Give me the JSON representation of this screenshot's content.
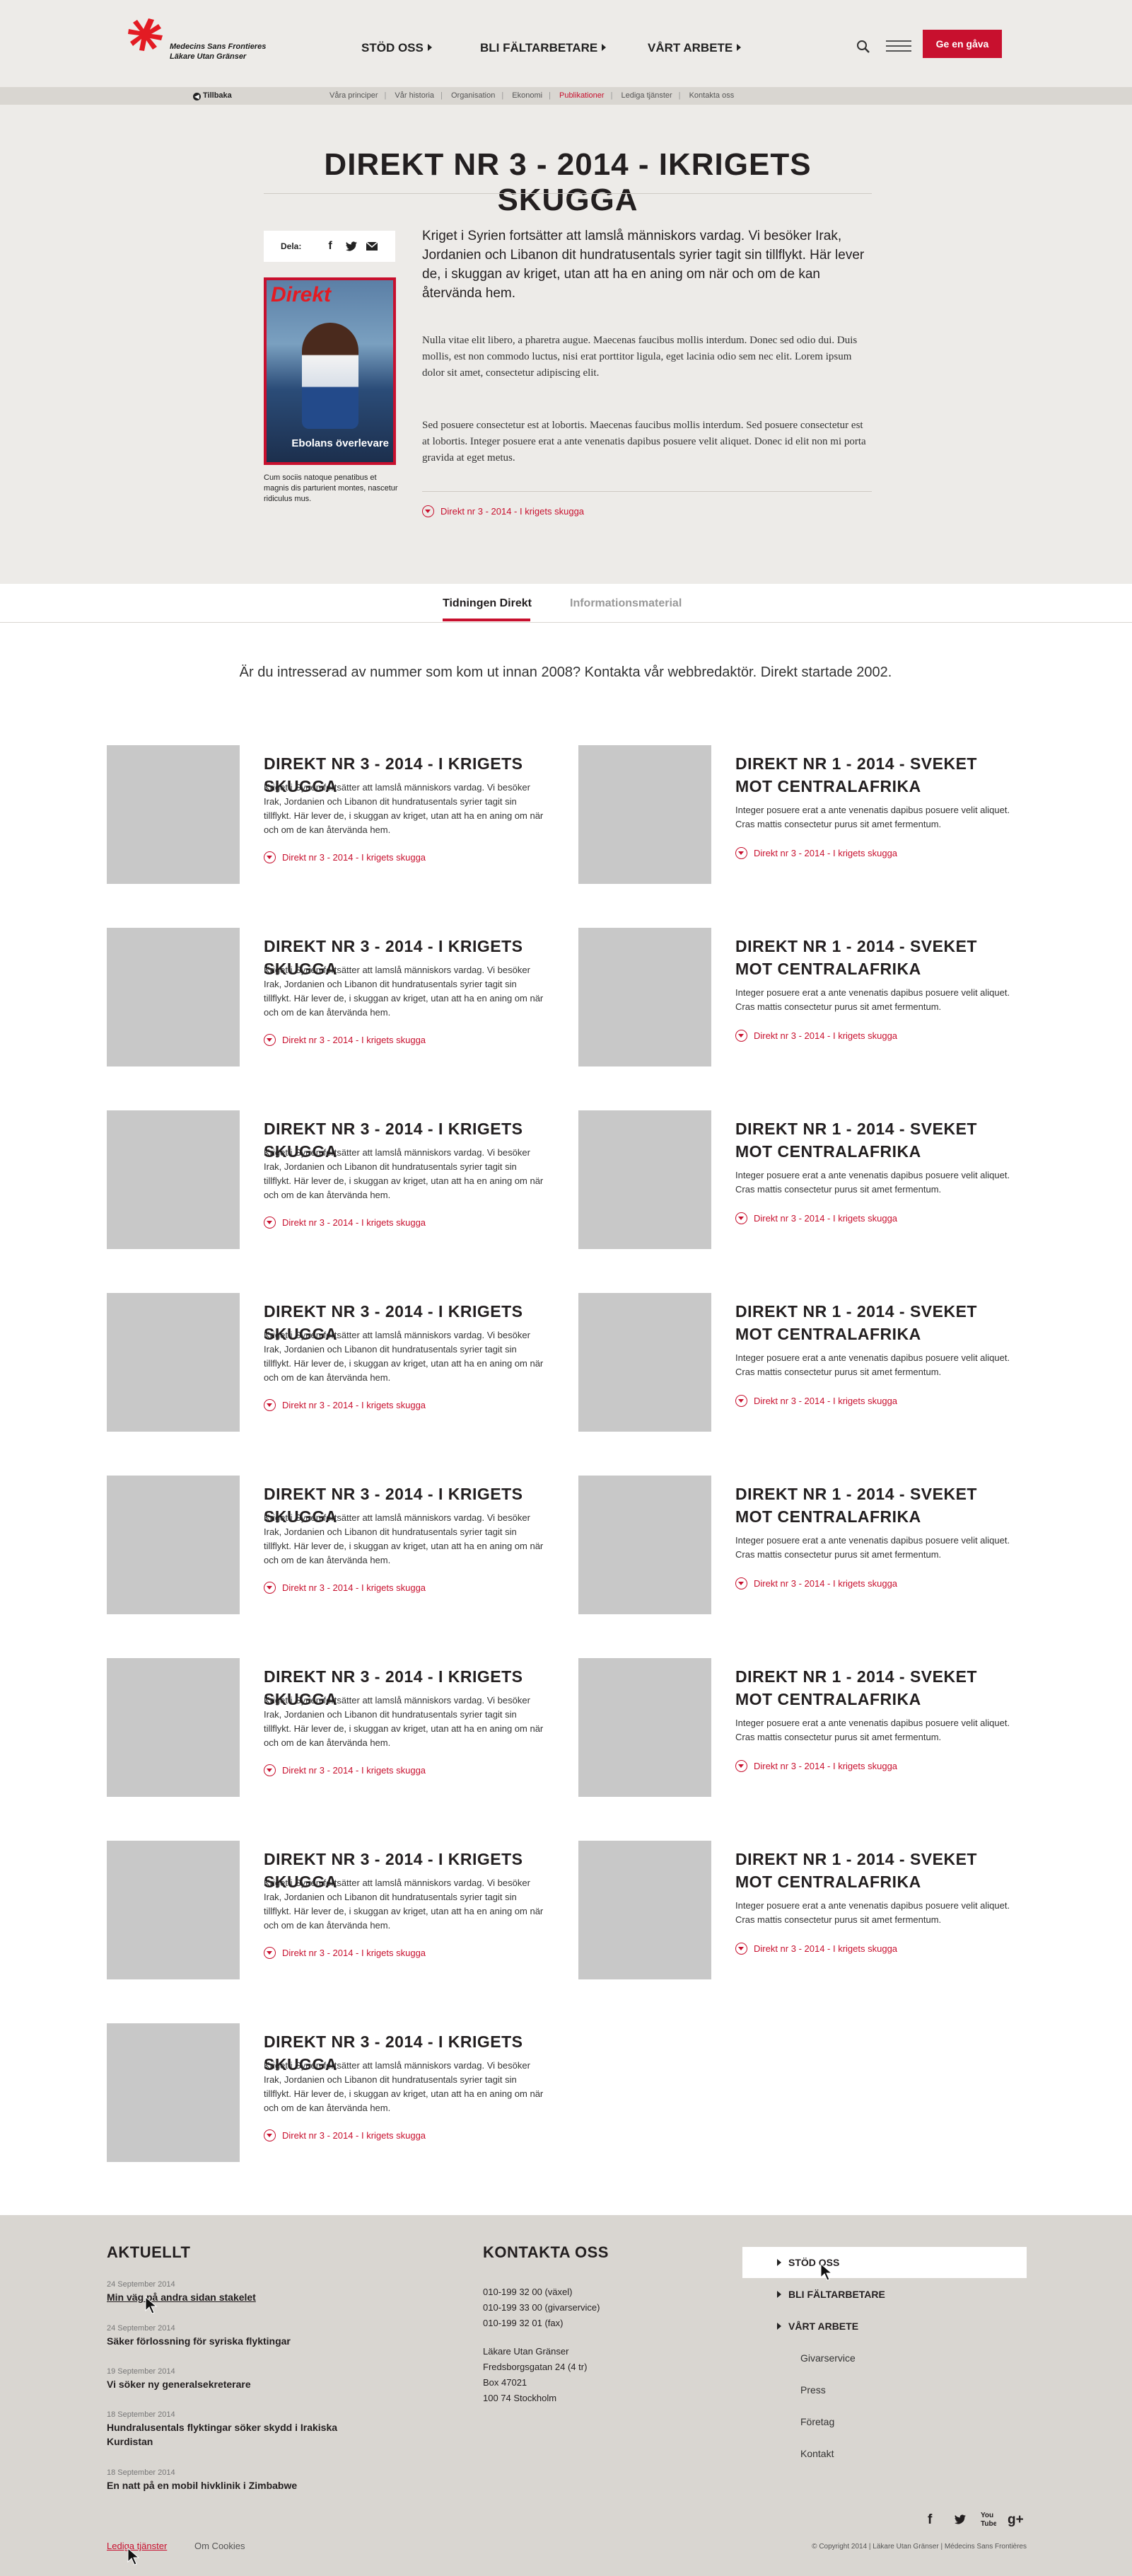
{
  "header": {
    "logo_line1": "Medecins Sans Frontieres",
    "logo_line2": "Läkare Utan Gränser",
    "nav": [
      {
        "label": "STÖD OSS"
      },
      {
        "label": "BLI FÄLTARBETARE"
      },
      {
        "label": "VÅRT ARBETE"
      }
    ],
    "search_icon": "search-icon",
    "menu_icon": "hamburger-icon",
    "donate_label": "Ge en gåva",
    "brand_color": "#c8102e"
  },
  "subnav": {
    "back_label": "Tillbaka",
    "links": [
      "Våra principer",
      "Vår historia",
      "Organisation",
      "Ekonomi",
      "Publikationer",
      "Lediga tjänster",
      "Kontakta oss"
    ],
    "active": "Publikationer"
  },
  "hero": {
    "title": "DIREKT NR 3 - 2014 - IKRIGETS SKUGGA",
    "share_label": "Dela:",
    "share_icons": [
      "facebook-icon",
      "twitter-icon",
      "email-icon"
    ],
    "cover_masthead": "Direkt",
    "cover_caption_text": "Ebolans överlevare",
    "cover_caption": "Cum sociis natoque penatibus et magnis dis parturient montes, nascetur ridiculus mus.",
    "lead": "Kriget i Syrien fortsätter att lamslå människors vardag. Vi besöker Irak, Jordanien och Libanon dit hundratusentals syrier tagit sin tillflykt. Här lever de, i skuggan av kriget, utan att ha en aning om när och om de kan återvända hem.",
    "body1": "Nulla vitae elit libero, a pharetra augue. Maecenas faucibus mollis interdum. Donec sed odio dui. Duis mollis, est non commodo luctus, nisi erat porttitor ligula, eget lacinia odio sem nec elit. Lorem ipsum dolor sit amet, consectetur adipiscing elit.",
    "body2": "Sed posuere consectetur est at lobortis. Maecenas faucibus mollis interdum. Sed posuere consectetur est at lobortis. Integer posuere erat a ante venenatis dapibus posuere velit aliquet. Donec id elit non mi porta gravida at eget metus.",
    "link": "Direkt nr 3 - 2014 - I krigets skugga"
  },
  "tabs": [
    {
      "label": "Tidningen Direkt",
      "active": true
    },
    {
      "label": "Informationsmaterial",
      "active": false
    }
  ],
  "intro": "Är du intresserad av nummer som kom ut innan 2008? Kontakta vår webbredaktör. Direkt startade 2002.",
  "cards_left": [
    {
      "title": "DIREKT NR 3 - 2014 - I KRIGETS SKUGGA",
      "text": "Kriget i Syrien fortsätter att lamslå människors vardag. Vi besöker Irak, Jordanien och Libanon dit hundratusentals syrier tagit sin tillflykt. Här lever de, i skuggan av kriget, utan att ha en aning om när och om de kan återvända hem.",
      "link": "Direkt nr 3 - 2014 - I krigets skugga"
    },
    {
      "title": "DIREKT NR 3 - 2014 - I KRIGETS SKUGGA",
      "text": "Kriget i Syrien fortsätter att lamslå människors vardag. Vi besöker Irak, Jordanien och Libanon dit hundratusentals syrier tagit sin tillflykt. Här lever de, i skuggan av kriget, utan att ha en aning om när och om de kan återvända hem.",
      "link": "Direkt nr 3 - 2014 - I krigets skugga"
    },
    {
      "title": "DIREKT NR 3 - 2014 - I KRIGETS SKUGGA",
      "text": "Kriget i Syrien fortsätter att lamslå människors vardag. Vi besöker Irak, Jordanien och Libanon dit hundratusentals syrier tagit sin tillflykt. Här lever de, i skuggan av kriget, utan att ha en aning om när och om de kan återvända hem.",
      "link": "Direkt nr 3 - 2014 - I krigets skugga"
    },
    {
      "title": "DIREKT NR 3 - 2014 - I KRIGETS SKUGGA",
      "text": "Kriget i Syrien fortsätter att lamslå människors vardag. Vi besöker Irak, Jordanien och Libanon dit hundratusentals syrier tagit sin tillflykt. Här lever de, i skuggan av kriget, utan att ha en aning om när och om de kan återvända hem.",
      "link": "Direkt nr 3 - 2014 - I krigets skugga"
    },
    {
      "title": "DIREKT NR 3 - 2014 - I KRIGETS SKUGGA",
      "text": "Kriget i Syrien fortsätter att lamslå människors vardag. Vi besöker Irak, Jordanien och Libanon dit hundratusentals syrier tagit sin tillflykt. Här lever de, i skuggan av kriget, utan att ha en aning om när och om de kan återvända hem.",
      "link": "Direkt nr 3 - 2014 - I krigets skugga"
    },
    {
      "title": "DIREKT NR 3 - 2014 - I KRIGETS SKUGGA",
      "text": "Kriget i Syrien fortsätter att lamslå människors vardag. Vi besöker Irak, Jordanien och Libanon dit hundratusentals syrier tagit sin tillflykt. Här lever de, i skuggan av kriget, utan att ha en aning om när och om de kan återvända hem.",
      "link": "Direkt nr 3 - 2014 - I krigets skugga"
    },
    {
      "title": "DIREKT NR 3 - 2014 - I KRIGETS SKUGGA",
      "text": "Kriget i Syrien fortsätter att lamslå människors vardag. Vi besöker Irak, Jordanien och Libanon dit hundratusentals syrier tagit sin tillflykt. Här lever de, i skuggan av kriget, utan att ha en aning om när och om de kan återvända hem.",
      "link": "Direkt nr 3 - 2014 - I krigets skugga"
    },
    {
      "title": "DIREKT NR 3 - 2014 - I KRIGETS SKUGGA",
      "text": "Kriget i Syrien fortsätter att lamslå människors vardag. Vi besöker Irak, Jordanien och Libanon dit hundratusentals syrier tagit sin tillflykt. Här lever de, i skuggan av kriget, utan att ha en aning om när och om de kan återvända hem.",
      "link": "Direkt nr 3 - 2014 - I krigets skugga"
    }
  ],
  "cards_right": [
    {
      "title": "DIREKT NR 1 - 2014 - SVEKET MOT CENTRALAFRIKA",
      "text": "Integer posuere erat a ante venenatis dapibus posuere velit aliquet. Cras mattis consectetur purus sit amet fermentum.",
      "link": "Direkt nr 3 - 2014 - I krigets skugga"
    },
    {
      "title": "DIREKT NR 1 - 2014 - SVEKET MOT CENTRALAFRIKA",
      "text": "Integer posuere erat a ante venenatis dapibus posuere velit aliquet. Cras mattis consectetur purus sit amet fermentum.",
      "link": "Direkt nr 3 - 2014 - I krigets skugga"
    },
    {
      "title": "DIREKT NR 1 - 2014 - SVEKET MOT CENTRALAFRIKA",
      "text": "Integer posuere erat a ante venenatis dapibus posuere velit aliquet. Cras mattis consectetur purus sit amet fermentum.",
      "link": "Direkt nr 3 - 2014 - I krigets skugga"
    },
    {
      "title": "DIREKT NR 1 - 2014 - SVEKET MOT CENTRALAFRIKA",
      "text": "Integer posuere erat a ante venenatis dapibus posuere velit aliquet. Cras mattis consectetur purus sit amet fermentum.",
      "link": "Direkt nr 3 - 2014 - I krigets skugga"
    },
    {
      "title": "DIREKT NR 1 - 2014 - SVEKET MOT CENTRALAFRIKA",
      "text": "Integer posuere erat a ante venenatis dapibus posuere velit aliquet. Cras mattis consectetur purus sit amet fermentum.",
      "link": "Direkt nr 3 - 2014 - I krigets skugga"
    },
    {
      "title": "DIREKT NR 1 - 2014 - SVEKET MOT CENTRALAFRIKA",
      "text": "Integer posuere erat a ante venenatis dapibus posuere velit aliquet. Cras mattis consectetur purus sit amet fermentum.",
      "link": "Direkt nr 3 - 2014 - I krigets skugga"
    },
    {
      "title": "DIREKT NR 1 - 2014 - SVEKET MOT CENTRALAFRIKA",
      "text": "Integer posuere erat a ante venenatis dapibus posuere velit aliquet. Cras mattis consectetur purus sit amet fermentum.",
      "link": "Direkt nr 3 - 2014 - I krigets skugga"
    }
  ],
  "footer": {
    "news_heading": "AKTUELLT",
    "news": [
      {
        "date": "24 September 2014",
        "title": "Min väg på andra sidan stakelet"
      },
      {
        "date": "24 September 2014",
        "title": "Säker förlossning för syriska flyktingar"
      },
      {
        "date": "19 September 2014",
        "title": "Vi söker ny generalsekreterare"
      },
      {
        "date": "18 September 2014",
        "title": "Hundralusentals flyktingar söker skydd i Irakiska Kurdistan"
      },
      {
        "date": "18 September 2014",
        "title": "En natt på en mobil hivklinik i Zimbabwe"
      }
    ],
    "contact_heading": "KONTAKTA OSS",
    "phones": "010-199 32 00 (växel)\n010-199 33 00 (givarservice)\n010-199 32 01 (fax)",
    "address": "Läkare Utan Gränser\nFredsborgsgatan 24 (4 tr)\nBox 47021\n100 74 Stockholm",
    "nav_main": [
      "STÖD OSS",
      "BLI FÄLTARBETARE",
      "VÅRT ARBETE"
    ],
    "nav_sub": [
      "Givarservice",
      "Press",
      "Företag",
      "Kontakt"
    ],
    "social_icons": [
      "facebook-icon",
      "twitter-icon",
      "youtube-icon",
      "googleplus-icon"
    ],
    "copyright": "© Copyright 2014 | Läkare Utan Gränser | Médecins Sans Frontières",
    "bottom_links": [
      "Lediga tjänster",
      "Om Cookies"
    ]
  }
}
